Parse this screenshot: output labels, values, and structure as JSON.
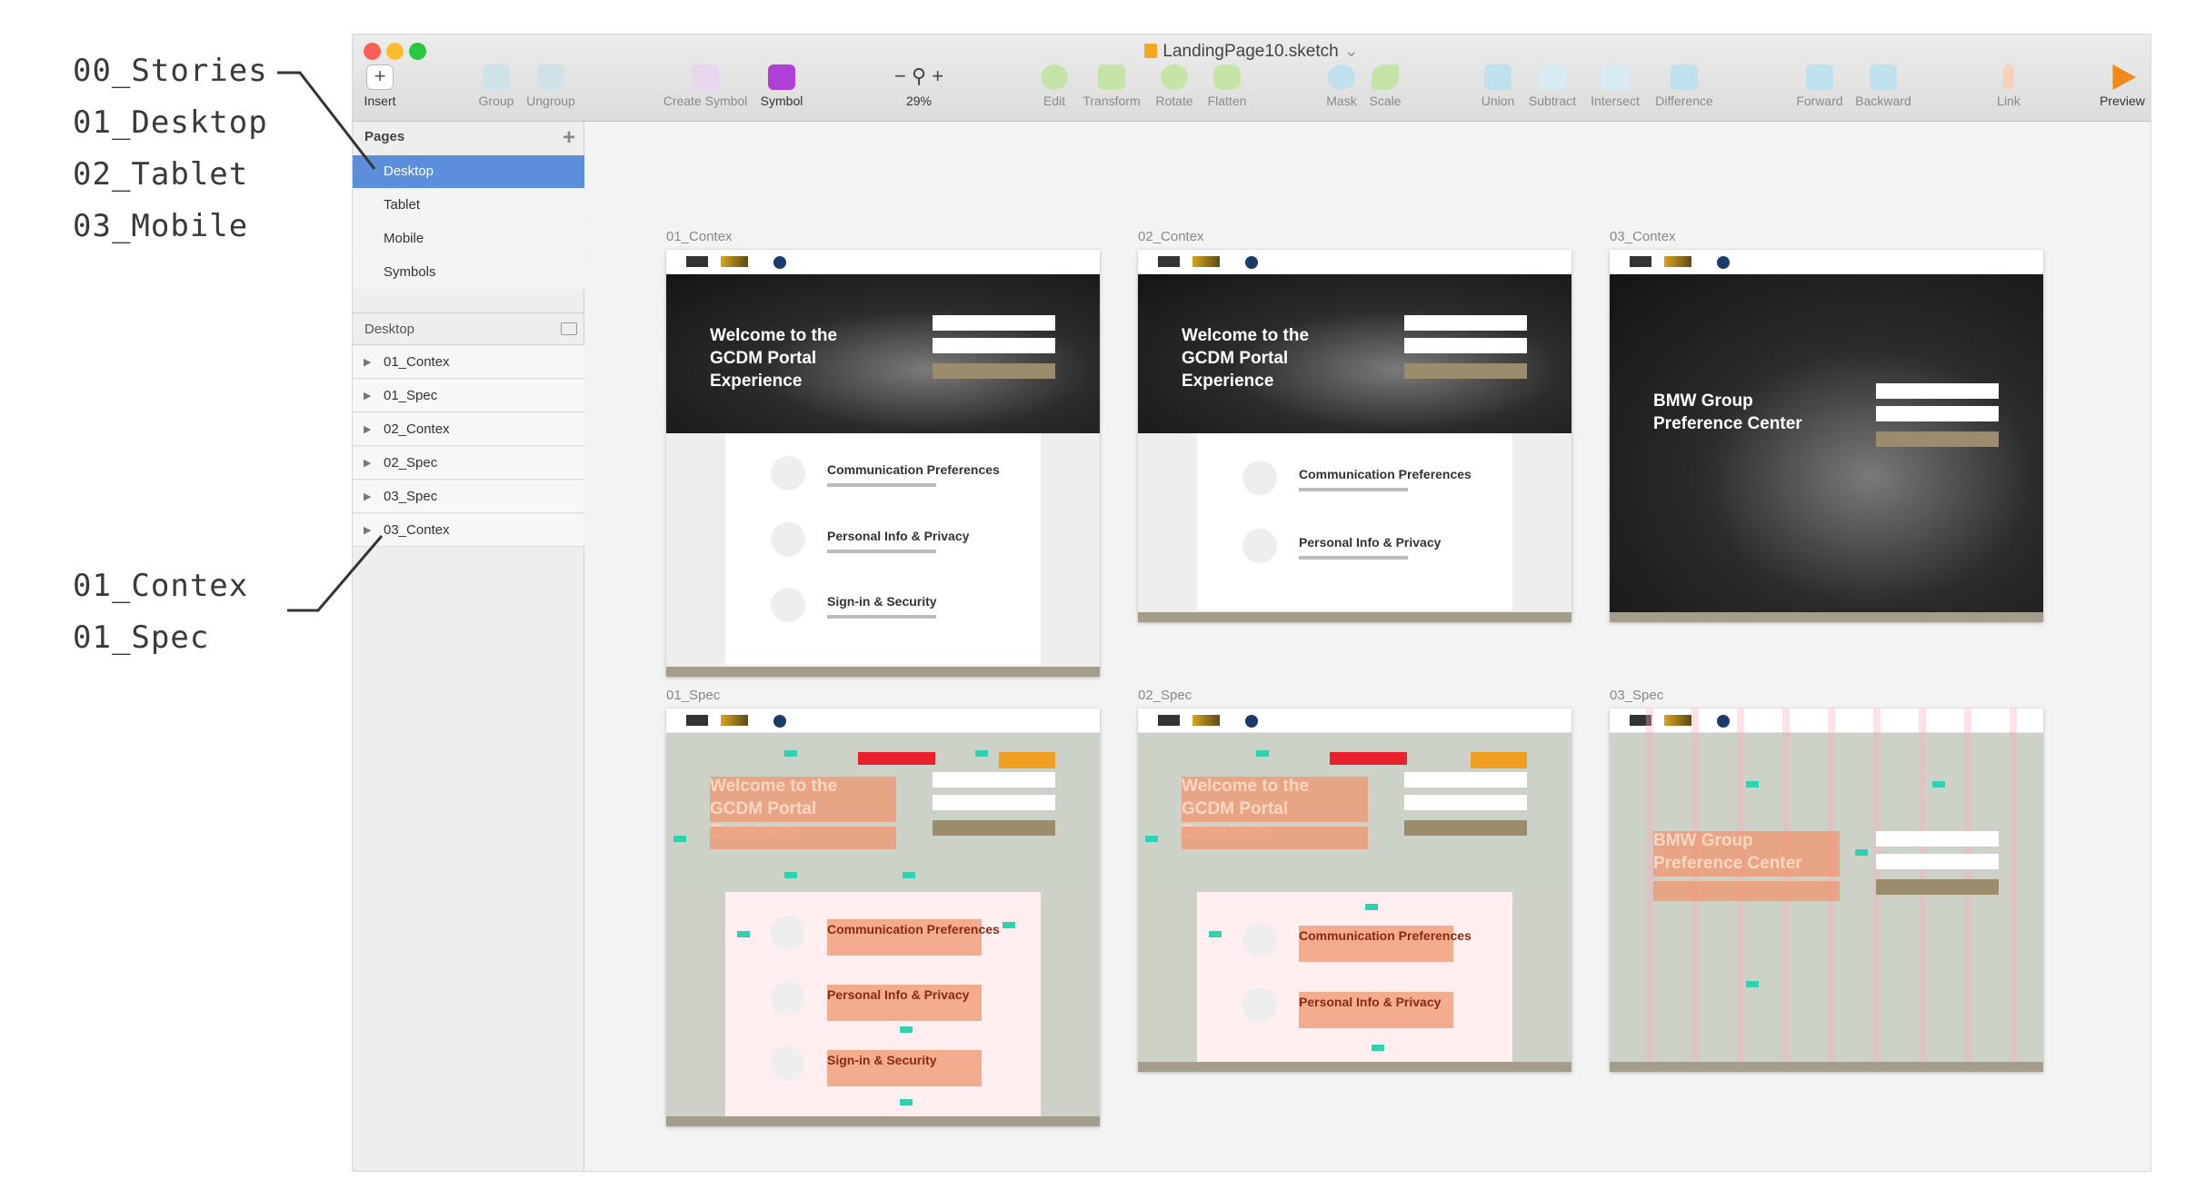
{
  "annotations": {
    "stories": [
      "00_Stories",
      "01_Desktop",
      "02_Tablet",
      "03_Mobile"
    ],
    "layers": [
      "01_Contex",
      "01_Spec"
    ]
  },
  "window": {
    "title": "LandingPage10.sketch",
    "toolbar": {
      "insert": "Insert",
      "group": "Group",
      "ungroup": "Ungroup",
      "create_symbol": "Create Symbol",
      "symbol": "Symbol",
      "zoom_minus": "−",
      "zoom_plus": "+",
      "zoom_level": "29%",
      "edit": "Edit",
      "transform": "Transform",
      "rotate": "Rotate",
      "flatten": "Flatten",
      "mask": "Mask",
      "scale": "Scale",
      "union": "Union",
      "subtract": "Subtract",
      "intersect": "Intersect",
      "difference": "Difference",
      "forward": "Forward",
      "backward": "Backward",
      "link": "Link",
      "preview": "Preview"
    }
  },
  "sidebar": {
    "pages_header": "Pages",
    "add_page": "+",
    "pages": [
      "Desktop",
      "Tablet",
      "Mobile",
      "Symbols"
    ],
    "selected_page": "Desktop",
    "layers_header": "Desktop",
    "layers": [
      "01_Contex",
      "01_Spec",
      "02_Contex",
      "02_Spec",
      "03_Spec",
      "03_Contex"
    ]
  },
  "artboards": [
    {
      "label": "01_Contex",
      "hero_title": "Welcome to the GCDM Portal Experience",
      "rows": [
        "Communication Preferences",
        "Personal Info & Privacy",
        "Sign-in & Security"
      ]
    },
    {
      "label": "02_Contex",
      "hero_title": "Welcome to the GCDM Portal Experience",
      "rows": [
        "Communication Preferences",
        "Personal Info & Privacy"
      ]
    },
    {
      "label": "03_Contex",
      "hero_title": "BMW Group Preference Center",
      "rows": []
    },
    {
      "label": "01_Spec",
      "hero_title": "Welcome to the GCDM Portal Experience",
      "rows": [
        "Communication Preferences",
        "Personal Info & Privacy",
        "Sign-in & Security"
      ]
    },
    {
      "label": "02_Spec",
      "hero_title": "Welcome to the GCDM Portal Experience",
      "rows": [
        "Communication Preferences",
        "Personal Info & Privacy"
      ]
    },
    {
      "label": "03_Spec",
      "hero_title": "BMW Group Preference Center",
      "rows": []
    }
  ],
  "colors": {
    "selection": "#5b8fdb",
    "close": "#fc5f57",
    "minimize": "#fdbc2e",
    "zoom": "#28c840",
    "symbol_accent": "#b03fd8",
    "preview_accent": "#f28a1a",
    "footer": "#a59d8c",
    "spec_orange": "#f0966e",
    "spec_cyan": "#2ed1b0"
  }
}
